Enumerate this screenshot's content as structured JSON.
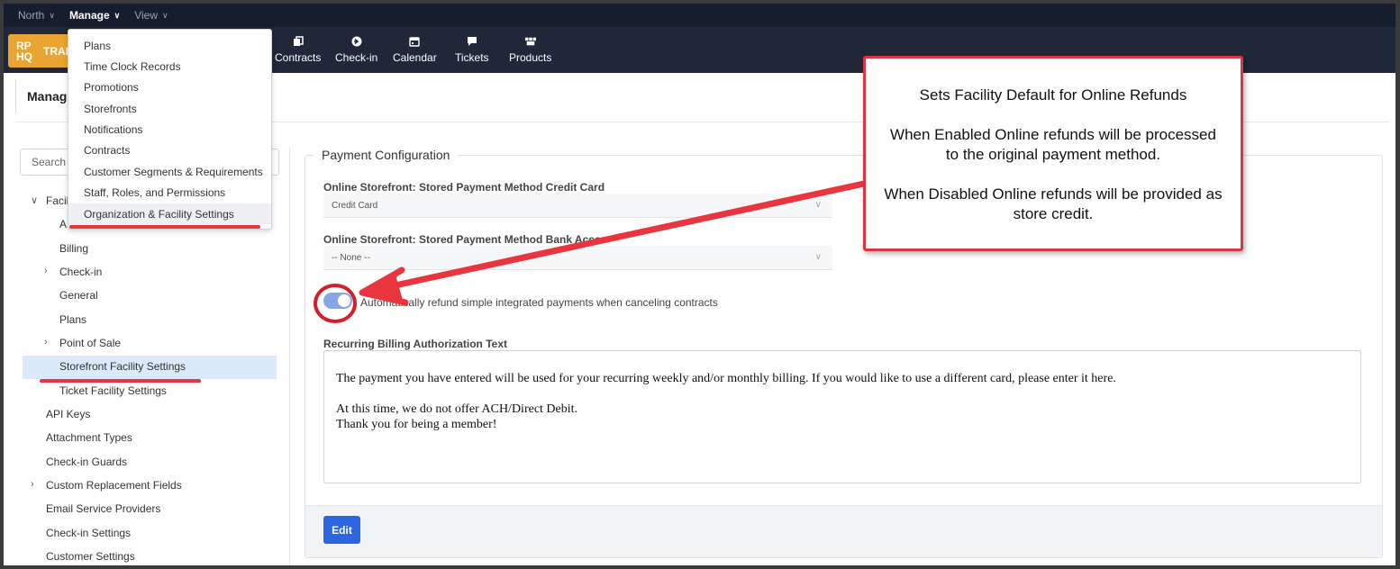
{
  "topbar": {
    "menus": [
      {
        "label": "North",
        "active": false
      },
      {
        "label": "Manage",
        "active": true
      },
      {
        "label": "View",
        "active": false
      }
    ]
  },
  "navbar": {
    "logo_mark": "RP HQ",
    "logo_text": "TRAI",
    "items": [
      {
        "label": "Contracts",
        "icon": "contracts-icon"
      },
      {
        "label": "Check-in",
        "icon": "arrow-right-circle-icon"
      },
      {
        "label": "Calendar",
        "icon": "calendar-icon"
      },
      {
        "label": "Tickets",
        "icon": "chat-bubble-icon"
      },
      {
        "label": "Products",
        "icon": "boxes-icon"
      }
    ]
  },
  "page": {
    "title": "Manag"
  },
  "dropdown": {
    "items": [
      "Plans",
      "Time Clock Records",
      "Promotions",
      "Storefronts",
      "Notifications",
      "Contracts",
      "Customer Segments & Requirements",
      "Staff, Roles, and Permissions",
      "Organization & Facility Settings"
    ],
    "highlighted_index": 8
  },
  "sidebar": {
    "search_placeholder": "Search (",
    "tree": [
      {
        "label": "Facil",
        "caret": "expanded",
        "level": 1
      },
      {
        "label": "A",
        "caret": null,
        "level": 2
      },
      {
        "label": "Billing",
        "caret": null,
        "level": 2
      },
      {
        "label": "Check-in",
        "caret": "collapsed",
        "level": 2
      },
      {
        "label": "General",
        "caret": null,
        "level": 2
      },
      {
        "label": "Plans",
        "caret": null,
        "level": 2
      },
      {
        "label": "Point of Sale",
        "caret": "collapsed",
        "level": 2
      },
      {
        "label": "Storefront Facility Settings",
        "caret": null,
        "level": 2,
        "selected": true
      },
      {
        "label": "Ticket Facility Settings",
        "caret": null,
        "level": 2
      },
      {
        "label": "API Keys",
        "caret": null,
        "level": 1
      },
      {
        "label": "Attachment Types",
        "caret": null,
        "level": 1
      },
      {
        "label": "Check-in Guards",
        "caret": null,
        "level": 1
      },
      {
        "label": "Custom Replacement Fields",
        "caret": "collapsed",
        "level": 1
      },
      {
        "label": "Email Service Providers",
        "caret": null,
        "level": 1
      },
      {
        "label": "Check-in Settings",
        "caret": null,
        "level": 1
      },
      {
        "label": "Customer Settings",
        "caret": null,
        "level": 1
      }
    ]
  },
  "main": {
    "section_title": "Payment Configuration",
    "credit_card_label": "Online Storefront: Stored Payment Method Credit Card",
    "credit_card_value": "Credit Card",
    "bank_label": "Online Storefront: Stored Payment Method Bank Acco",
    "bank_value": "-- None --",
    "toggle_label": "Automatically refund simple integrated payments when canceling contracts",
    "toggle_enabled": true,
    "recurring_label": "Recurring Billing Authorization Text",
    "recurring_text_1": "The payment you have entered will be used for your recurring weekly and/or monthly billing. If you would like to use a different card, please enter it here.",
    "recurring_text_2": "At this time, we do not offer ACH/Direct Debit.\nThank you for being a member!",
    "edit_label": "Edit"
  },
  "callout": {
    "line1": "Sets Facility Default for Online Refunds",
    "line2": "When Enabled Online refunds will be processed to the original payment method.",
    "line3": "When Disabled Online refunds will be provided as store credit."
  },
  "colors": {
    "topbar": "#161d2c",
    "navbar": "#1f2738",
    "logo": "#e9a431",
    "accent": "#2b65e0",
    "annotation": "#e8353e",
    "selected": "#dce9fb"
  }
}
